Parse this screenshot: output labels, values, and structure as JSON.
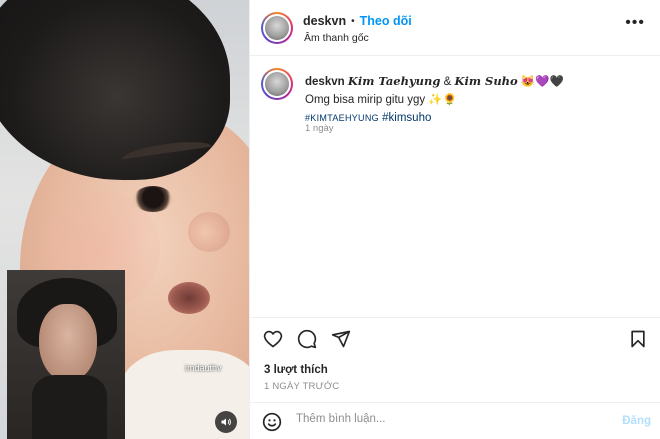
{
  "header": {
    "username": "deskvn",
    "separator": "•",
    "follow_label": "Theo dõi",
    "audio_label": "Âm thanh gốc",
    "more_icon": "more-horizontal-icon"
  },
  "media": {
    "watermark": "imdauthv"
  },
  "caption": {
    "username": "deskvn",
    "name1": "Kim Taehyung",
    "amp": " & ",
    "name2": "Kim Suho",
    "emojis": "😻💜🖤",
    "line2": "Omg bisa mirip gitu ygy ✨🌻",
    "tag1": "#KIMTAEHYUNG",
    "tag2": "#kimsuho",
    "time": "1 ngày"
  },
  "actions": {
    "likes": "3 lượt thích",
    "ago": "1 NGÀY TRƯỚC"
  },
  "comment": {
    "placeholder": "Thêm bình luận...",
    "post_label": "Đăng"
  },
  "colors": {
    "accent": "#0095f6",
    "post_disabled": "#b2dffc"
  }
}
